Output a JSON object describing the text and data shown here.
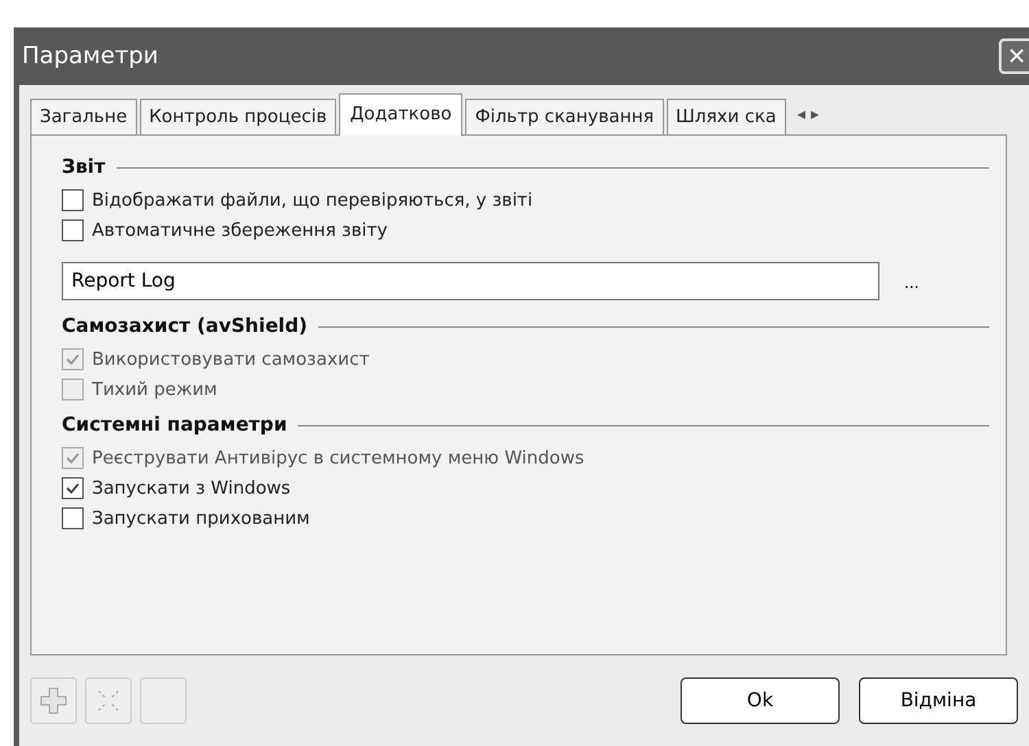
{
  "window": {
    "title": "Параметри",
    "close": "×"
  },
  "tabs": [
    {
      "label": "Загальне",
      "selected": false
    },
    {
      "label": "Контроль процесів",
      "selected": false
    },
    {
      "label": "Додатково",
      "selected": true
    },
    {
      "label": "Фільтр сканування",
      "selected": false
    },
    {
      "label": "Шляхи ска",
      "selected": false
    }
  ],
  "tab_scroll": [
    "◂",
    "▸"
  ],
  "sections": [
    {
      "title": "Звіт",
      "items": [
        {
          "kind": "checkbox",
          "label": "Відображати файли, що перевіряються, у звіті",
          "checked": false,
          "disabled": false
        },
        {
          "kind": "checkbox",
          "label": "Автоматичне збереження звіту",
          "checked": false,
          "disabled": false
        },
        {
          "kind": "field",
          "value": "Report Log",
          "button": "..."
        }
      ]
    },
    {
      "title": "Самозахист (avShield)",
      "items": [
        {
          "kind": "checkbox",
          "label": "Використовувати самозахист",
          "checked": true,
          "disabled": true
        },
        {
          "kind": "checkbox",
          "label": "Тихий режим",
          "checked": false,
          "disabled": true
        }
      ]
    },
    {
      "title": "Системні параметри",
      "items": [
        {
          "kind": "checkbox",
          "label": "Реєструвати Антивірус в системному меню Windows",
          "checked": true,
          "disabled": true
        },
        {
          "kind": "checkbox",
          "label": "Запускати з Windows",
          "checked": true,
          "disabled": false
        },
        {
          "kind": "checkbox",
          "label": "Запускати прихованим",
          "checked": false,
          "disabled": false
        }
      ]
    }
  ],
  "buttons": [
    "Ok",
    "Відміна"
  ]
}
